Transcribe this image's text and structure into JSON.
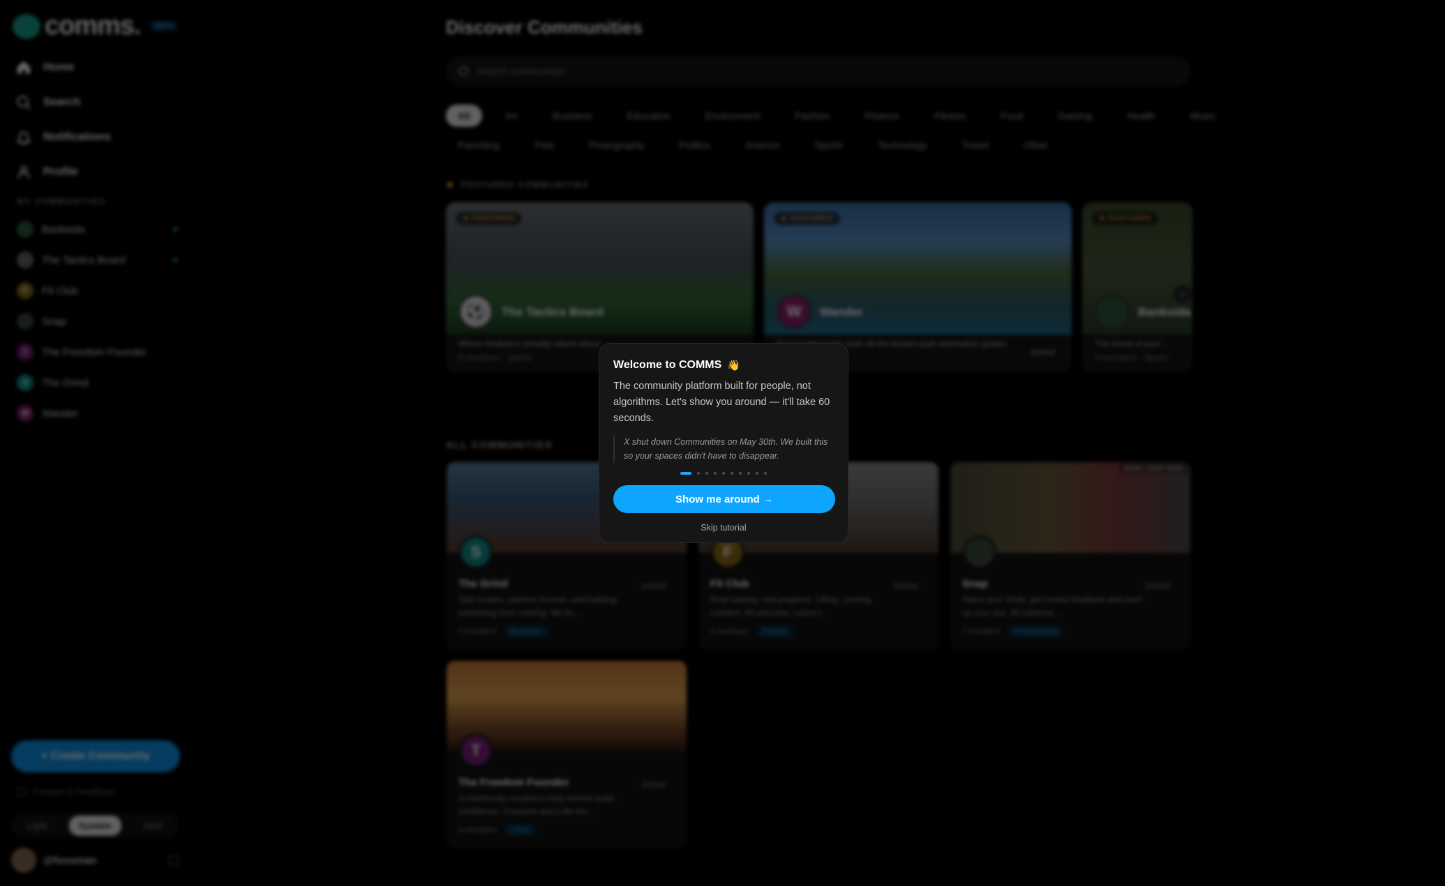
{
  "app": {
    "logo_text": "comms.",
    "beta_badge": "BETA"
  },
  "nav": [
    {
      "label": "Home"
    },
    {
      "label": "Search"
    },
    {
      "label": "Notifications"
    },
    {
      "label": "Profile"
    }
  ],
  "my_communities": {
    "heading": "MY COMMUNITIES",
    "items": [
      {
        "label": "Banksida",
        "initial": "",
        "color": "#2f5a3a",
        "unread": true
      },
      {
        "label": "The Tactics Board",
        "initial": "",
        "color": "#666666",
        "unread": true
      },
      {
        "label": "Fit Club",
        "initial": "F",
        "color": "#8a6a1a",
        "unread": false
      },
      {
        "label": "Snap",
        "initial": "",
        "color": "#3a4a3a",
        "unread": false
      },
      {
        "label": "The Freedom Founder",
        "initial": "T",
        "color": "#7a1f7a",
        "unread": false
      },
      {
        "label": "The Grind",
        "initial": "S",
        "color": "#0f8a8a",
        "unread": false
      },
      {
        "label": "Wander",
        "initial": "W",
        "color": "#8a1f6a",
        "unread": false
      }
    ]
  },
  "sidebar_footer": {
    "create_label": "+ Create Community",
    "contact_label": "Contact & Feedback",
    "theme_options": [
      "Light",
      "System",
      "Dark"
    ],
    "theme_selected": "System",
    "username": "@foxsman"
  },
  "main": {
    "title": "Discover Communities",
    "search_placeholder": "Search communities",
    "categories_row1": [
      "All",
      "Art",
      "Business",
      "Education",
      "Environment",
      "Fashion",
      "Finance",
      "Fitness",
      "Food",
      "Gaming",
      "Health",
      "Music"
    ],
    "categories_row2": [
      "Parenting",
      "Pets",
      "Photography",
      "Politics",
      "Science",
      "Sports",
      "Technology",
      "Travel",
      "Other"
    ],
    "category_selected": "All",
    "featured_heading": "FEATURED COMMUNITIES",
    "featured_badge": "★ FEATURED",
    "featured": [
      {
        "name": "The Tactics Board",
        "initial": "",
        "desc": "Where football is actually talked about",
        "meta": "8 members · Sports",
        "joined": ""
      },
      {
        "name": "Wander",
        "initial": "W",
        "desc": "For travellers who seek off-the-beaten-path destination guides",
        "meta": "",
        "joined": "Joined"
      },
      {
        "name": "Banksida",
        "initial": "",
        "desc": "The home of your…",
        "meta": "4 members · Sports",
        "joined": ""
      }
    ],
    "all_heading": "ALL COMMUNITIES",
    "all": [
      {
        "name": "The Grind",
        "initial": "S",
        "desc": "Side hustles, passive income, and building something from nothing. We fix…",
        "members": "5 members",
        "tag": "Business",
        "joined": "Joined"
      },
      {
        "name": "Fit Club",
        "initial": "F",
        "desc": "Real training, real progress. Lifting, running, nutrition. All welcome. Leave t…",
        "members": "5 members",
        "tag": "Fitness",
        "joined": "Joined"
      },
      {
        "name": "Snap",
        "initial": "",
        "desc": "Share your shots, get honest feedback and level up your eye. All cameras…",
        "members": "7 members",
        "tag": "Photography",
        "joined": "Joined",
        "corner": "BORN / SNAP SEEN"
      },
      {
        "name": "The Freedom Founder",
        "initial": "T",
        "desc": "A community created to help women build confidence. Freedom and a life the…",
        "members": "4 members",
        "tag": "Other",
        "joined": "Joined"
      }
    ]
  },
  "modal": {
    "title": "Welcome to COMMS",
    "wave_emoji": "👋",
    "body": "The community platform built for people, not algorithms. Let's show you around — it'll take 60 seconds.",
    "quote": "X shut down Communities on May 30th. We built this so your spaces didn't have to disappear.",
    "steps_total": 10,
    "step_current": 1,
    "primary_label": "Show me around →",
    "skip_label": "Skip tutorial"
  }
}
